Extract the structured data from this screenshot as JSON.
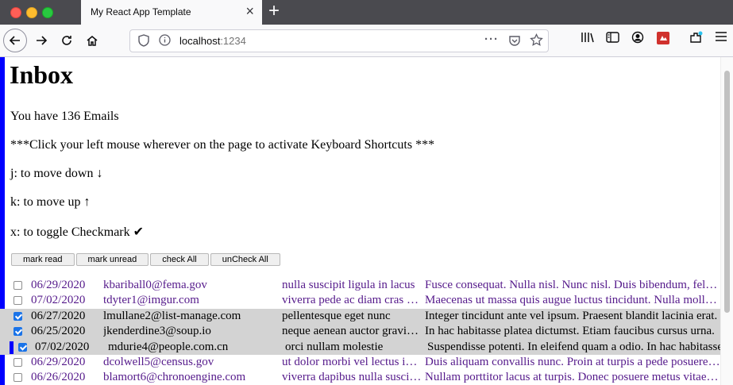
{
  "browser": {
    "tab_title": "My React App Template",
    "url_host": "localhost",
    "url_port": ":1234"
  },
  "page": {
    "heading": "Inbox",
    "count_text": "You have 136 Emails",
    "instruction": "***Click your left mouse wherever on the page to activate Keyboard Shortcuts ***",
    "shortcut_down": "j: to move down ↓",
    "shortcut_up": "k: to move up ↑",
    "shortcut_toggle": "x: to toggle Checkmark ✔",
    "buttons": {
      "mark_read": "mark read",
      "mark_unread": "mark unread",
      "check_all": "check All",
      "uncheck_all": "unCheck All"
    }
  },
  "emails": [
    {
      "checked": false,
      "selected": false,
      "current": false,
      "date": "06/29/2020",
      "email": "kbariball0@fema.gov",
      "subject": "nulla suscipit ligula in lacus",
      "body": "Fusce consequat. Nulla nisl. Nunc nisl. Duis bibendum, felis sed"
    },
    {
      "checked": false,
      "selected": false,
      "current": false,
      "date": "07/02/2020",
      "email": "tdyter1@imgur.com",
      "subject": "viverra pede ac diam cras pellentesque",
      "body": "Maecenas ut massa quis augue luctus tincidunt. Nulla mollis molestie"
    },
    {
      "checked": true,
      "selected": true,
      "current": false,
      "date": "06/27/2020",
      "email": "lmullane2@list-manage.com",
      "subject": "pellentesque eget nunc",
      "body": "Integer tincidunt ante vel ipsum. Praesent blandit lacinia erat."
    },
    {
      "checked": true,
      "selected": true,
      "current": false,
      "date": "06/25/2020",
      "email": "jkenderdine3@soup.io",
      "subject": "neque aenean auctor gravida sem",
      "body": "In hac habitasse platea dictumst. Etiam faucibus cursus urna."
    },
    {
      "checked": true,
      "selected": true,
      "current": true,
      "date": "07/02/2020",
      "email": "mdurie4@people.com.cn",
      "subject": "orci nullam molestie",
      "body": "Suspendisse potenti. In eleifend quam a odio. In hac habitasse"
    },
    {
      "checked": false,
      "selected": false,
      "current": false,
      "date": "06/29/2020",
      "email": "dcolwell5@census.gov",
      "subject": "ut dolor morbi vel lectus in quam",
      "body": "Duis aliquam convallis nunc. Proin at turpis a pede posuere nonummy."
    },
    {
      "checked": false,
      "selected": false,
      "current": false,
      "date": "06/26/2020",
      "email": "blamort6@chronoengine.com",
      "subject": "viverra dapibus nulla suscipit ligula",
      "body": "Nullam porttitor lacus at turpis. Donec posuere metus vitae ipsum."
    }
  ],
  "icons": [
    "back-arrow-icon",
    "forward-arrow-icon",
    "reload-icon",
    "home-icon",
    "shield-icon",
    "info-icon",
    "more-icon",
    "pocket-icon",
    "bookmark-star-icon",
    "library-icon",
    "sidebar-icon",
    "account-icon",
    "extension-icon",
    "puzzle-icon",
    "menu-icon"
  ]
}
